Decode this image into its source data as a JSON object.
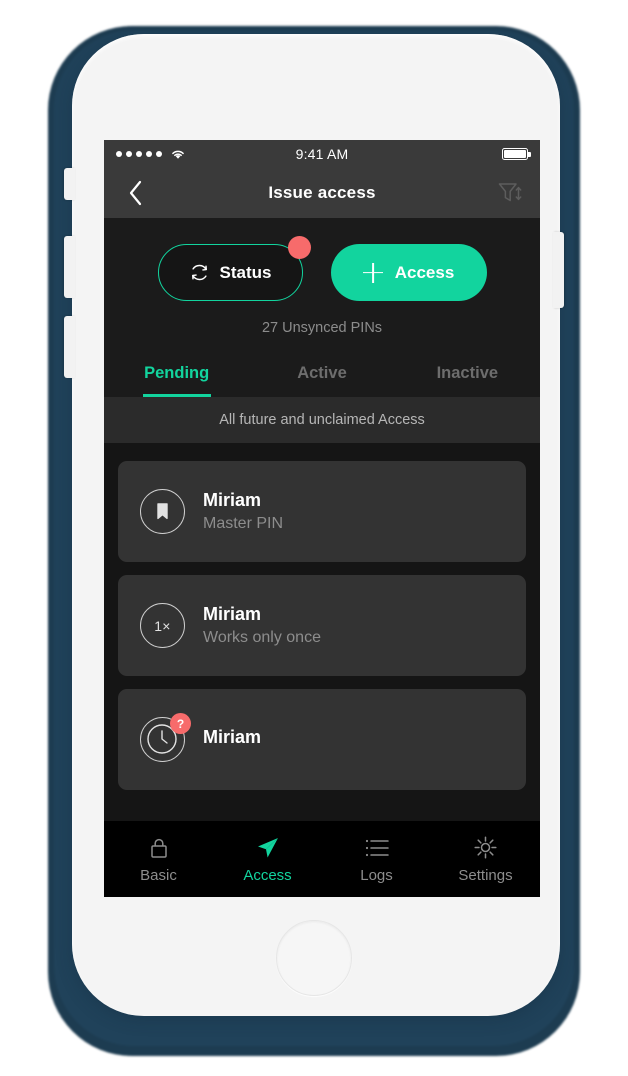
{
  "theme": {
    "accent": "#12d49e",
    "badge_red": "#f76b6b",
    "screen_bg": "#151515",
    "card_bg": "#333333",
    "navbar_bg": "#3a3a3a",
    "frame_shadow": "#20425a"
  },
  "status_bar": {
    "signal_dots": 5,
    "wifi_icon": "wifi-icon",
    "time": "9:41 AM",
    "battery_icon": "battery-full-icon"
  },
  "nav_bar": {
    "back_icon": "chevron-left-icon",
    "title": "Issue access",
    "filter_icon": "filter-sort-icon"
  },
  "actions": {
    "status_button": {
      "icon": "sync-refresh-icon",
      "label": "Status",
      "badge": true
    },
    "access_button": {
      "icon": "plus-icon",
      "label": "Access"
    },
    "unsynced_text": "27 Unsynced PINs"
  },
  "tabs": [
    {
      "label": "Pending",
      "active": true
    },
    {
      "label": "Active",
      "active": false
    },
    {
      "label": "Inactive",
      "active": false
    }
  ],
  "subtitle": "All future and unclaimed Access",
  "access_list": [
    {
      "icon": "bookmark-icon",
      "icon_text": "",
      "title": "Miriam",
      "subtitle": "Master PIN",
      "badge": ""
    },
    {
      "icon": "one-time-icon",
      "icon_text": "1×",
      "title": "Miriam",
      "subtitle": "Works only once",
      "badge": ""
    },
    {
      "icon": "clock-icon",
      "icon_text": "",
      "title": "Miriam",
      "subtitle": "",
      "badge": "?"
    }
  ],
  "bottom_nav": [
    {
      "icon": "lock-icon",
      "label": "Basic",
      "active": false
    },
    {
      "icon": "send-icon",
      "label": "Access",
      "active": true
    },
    {
      "icon": "list-icon",
      "label": "Logs",
      "active": false
    },
    {
      "icon": "gear-icon",
      "label": "Settings",
      "active": false
    }
  ]
}
